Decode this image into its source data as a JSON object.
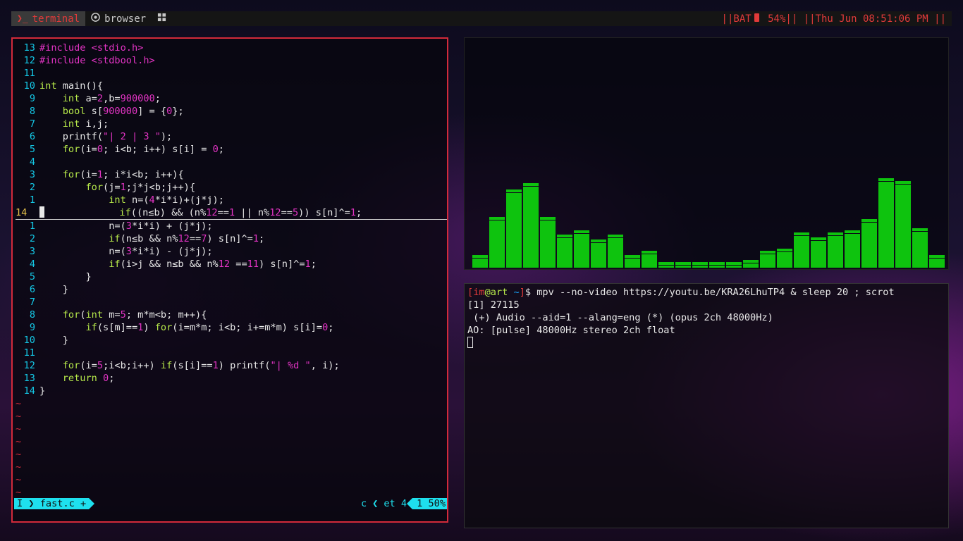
{
  "colors": {
    "accent_red": "#e03a3a",
    "cyan": "#1ee0ee",
    "keyword_green": "#b6e84a",
    "literal_magenta": "#e334c4",
    "visualizer_green": "#0ec30e"
  },
  "topbar": {
    "workspaces": [
      {
        "label": "terminal",
        "icon": "terminal-icon"
      },
      {
        "label": "browser",
        "icon": "chrome-icon"
      },
      {
        "label": "",
        "icon": "grid-icon"
      }
    ],
    "status_prefix": "||BAT",
    "battery_icon": "battery-icon",
    "battery_text": " 54%|| ||Thu Jun 08:51:06 PM ||"
  },
  "vim": {
    "lines": [
      {
        "ln": "13",
        "tokens": [
          {
            "t": "#include ",
            "c": "n"
          },
          {
            "t": "<stdio.h>",
            "c": "s"
          }
        ]
      },
      {
        "ln": "12",
        "tokens": [
          {
            "t": "#include ",
            "c": "n"
          },
          {
            "t": "<stdbool.h>",
            "c": "s"
          }
        ]
      },
      {
        "ln": "11",
        "tokens": []
      },
      {
        "ln": "10",
        "tokens": [
          {
            "t": "int",
            "c": "k"
          },
          {
            "t": " main(){",
            "c": "t"
          }
        ]
      },
      {
        "ln": "9",
        "tokens": [
          {
            "t": "    ",
            "c": "t"
          },
          {
            "t": "int",
            "c": "k"
          },
          {
            "t": " a=",
            "c": "t"
          },
          {
            "t": "2",
            "c": "n"
          },
          {
            "t": ",b=",
            "c": "t"
          },
          {
            "t": "900000",
            "c": "n"
          },
          {
            "t": ";",
            "c": "t"
          }
        ]
      },
      {
        "ln": "8",
        "tokens": [
          {
            "t": "    ",
            "c": "t"
          },
          {
            "t": "bool",
            "c": "k"
          },
          {
            "t": " s[",
            "c": "t"
          },
          {
            "t": "900000",
            "c": "n"
          },
          {
            "t": "] = {",
            "c": "t"
          },
          {
            "t": "0",
            "c": "n"
          },
          {
            "t": "};",
            "c": "t"
          }
        ]
      },
      {
        "ln": "7",
        "tokens": [
          {
            "t": "    ",
            "c": "t"
          },
          {
            "t": "int",
            "c": "k"
          },
          {
            "t": " i,j;",
            "c": "t"
          }
        ]
      },
      {
        "ln": "6",
        "tokens": [
          {
            "t": "    printf(",
            "c": "t"
          },
          {
            "t": "\"| 2 | 3 \"",
            "c": "s"
          },
          {
            "t": ");",
            "c": "t"
          }
        ]
      },
      {
        "ln": "5",
        "tokens": [
          {
            "t": "    ",
            "c": "t"
          },
          {
            "t": "for",
            "c": "k"
          },
          {
            "t": "(i=",
            "c": "t"
          },
          {
            "t": "0",
            "c": "n"
          },
          {
            "t": "; i<b; i++) s[i] = ",
            "c": "t"
          },
          {
            "t": "0",
            "c": "n"
          },
          {
            "t": ";",
            "c": "t"
          }
        ]
      },
      {
        "ln": "4",
        "tokens": []
      },
      {
        "ln": "3",
        "tokens": [
          {
            "t": "    ",
            "c": "t"
          },
          {
            "t": "for",
            "c": "k"
          },
          {
            "t": "(i=",
            "c": "t"
          },
          {
            "t": "1",
            "c": "n"
          },
          {
            "t": "; i*i<b; i++){",
            "c": "t"
          }
        ]
      },
      {
        "ln": "2",
        "tokens": [
          {
            "t": "        ",
            "c": "t"
          },
          {
            "t": "for",
            "c": "k"
          },
          {
            "t": "(j=",
            "c": "t"
          },
          {
            "t": "1",
            "c": "n"
          },
          {
            "t": ";j*j<b;j++){",
            "c": "t"
          }
        ]
      },
      {
        "ln": "1",
        "tokens": [
          {
            "t": "            ",
            "c": "t"
          },
          {
            "t": "int",
            "c": "k"
          },
          {
            "t": " n=(",
            "c": "t"
          },
          {
            "t": "4",
            "c": "n"
          },
          {
            "t": "*i*i)+(j*j);",
            "c": "t"
          }
        ]
      },
      {
        "ln": "14",
        "current": true,
        "tokens": [
          {
            "t": "            ",
            "c": "t"
          },
          {
            "t": "if",
            "c": "k"
          },
          {
            "t": "((n≤b) && (n%",
            "c": "t"
          },
          {
            "t": "12",
            "c": "n"
          },
          {
            "t": "==",
            "c": "t"
          },
          {
            "t": "1",
            "c": "n"
          },
          {
            "t": " || n%",
            "c": "t"
          },
          {
            "t": "12",
            "c": "n"
          },
          {
            "t": "==",
            "c": "t"
          },
          {
            "t": "5",
            "c": "n"
          },
          {
            "t": ")) s[n]^=",
            "c": "t"
          },
          {
            "t": "1",
            "c": "n"
          },
          {
            "t": ";",
            "c": "t"
          }
        ]
      },
      {
        "ln": "1",
        "tokens": [
          {
            "t": "            n=(",
            "c": "t"
          },
          {
            "t": "3",
            "c": "n"
          },
          {
            "t": "*i*i) + (j*j);",
            "c": "t"
          }
        ]
      },
      {
        "ln": "2",
        "tokens": [
          {
            "t": "            ",
            "c": "t"
          },
          {
            "t": "if",
            "c": "k"
          },
          {
            "t": "(n≤b && n%",
            "c": "t"
          },
          {
            "t": "12",
            "c": "n"
          },
          {
            "t": "==",
            "c": "t"
          },
          {
            "t": "7",
            "c": "n"
          },
          {
            "t": ") s[n]^=",
            "c": "t"
          },
          {
            "t": "1",
            "c": "n"
          },
          {
            "t": ";",
            "c": "t"
          }
        ]
      },
      {
        "ln": "3",
        "tokens": [
          {
            "t": "            n=(",
            "c": "t"
          },
          {
            "t": "3",
            "c": "n"
          },
          {
            "t": "*i*i) - (j*j);",
            "c": "t"
          }
        ]
      },
      {
        "ln": "4",
        "tokens": [
          {
            "t": "            ",
            "c": "t"
          },
          {
            "t": "if",
            "c": "k"
          },
          {
            "t": "(i>j && n≤b && n%",
            "c": "t"
          },
          {
            "t": "12",
            "c": "n"
          },
          {
            "t": " ==",
            "c": "t"
          },
          {
            "t": "11",
            "c": "n"
          },
          {
            "t": ") s[n]^=",
            "c": "t"
          },
          {
            "t": "1",
            "c": "n"
          },
          {
            "t": ";",
            "c": "t"
          }
        ]
      },
      {
        "ln": "5",
        "tokens": [
          {
            "t": "        }",
            "c": "t"
          }
        ]
      },
      {
        "ln": "6",
        "tokens": [
          {
            "t": "    }",
            "c": "t"
          }
        ]
      },
      {
        "ln": "7",
        "tokens": []
      },
      {
        "ln": "8",
        "tokens": [
          {
            "t": "    ",
            "c": "t"
          },
          {
            "t": "for",
            "c": "k"
          },
          {
            "t": "(",
            "c": "t"
          },
          {
            "t": "int",
            "c": "k"
          },
          {
            "t": " m=",
            "c": "t"
          },
          {
            "t": "5",
            "c": "n"
          },
          {
            "t": "; m*m<b; m++){",
            "c": "t"
          }
        ]
      },
      {
        "ln": "9",
        "tokens": [
          {
            "t": "        ",
            "c": "t"
          },
          {
            "t": "if",
            "c": "k"
          },
          {
            "t": "(s[m]==",
            "c": "t"
          },
          {
            "t": "1",
            "c": "n"
          },
          {
            "t": ") ",
            "c": "t"
          },
          {
            "t": "for",
            "c": "k"
          },
          {
            "t": "(i=m*m; i<b; i+=m*m) s[i]=",
            "c": "t"
          },
          {
            "t": "0",
            "c": "n"
          },
          {
            "t": ";",
            "c": "t"
          }
        ]
      },
      {
        "ln": "10",
        "tokens": [
          {
            "t": "    }",
            "c": "t"
          }
        ]
      },
      {
        "ln": "11",
        "tokens": []
      },
      {
        "ln": "12",
        "tokens": [
          {
            "t": "    ",
            "c": "t"
          },
          {
            "t": "for",
            "c": "k"
          },
          {
            "t": "(i=",
            "c": "t"
          },
          {
            "t": "5",
            "c": "n"
          },
          {
            "t": ";i<b;i++) ",
            "c": "t"
          },
          {
            "t": "if",
            "c": "k"
          },
          {
            "t": "(s[i]==",
            "c": "t"
          },
          {
            "t": "1",
            "c": "n"
          },
          {
            "t": ") printf(",
            "c": "t"
          },
          {
            "t": "\"| %d \"",
            "c": "s"
          },
          {
            "t": ", i);",
            "c": "t"
          }
        ]
      },
      {
        "ln": "13",
        "tokens": [
          {
            "t": "    ",
            "c": "t"
          },
          {
            "t": "return",
            "c": "k"
          },
          {
            "t": " ",
            "c": "t"
          },
          {
            "t": "0",
            "c": "n"
          },
          {
            "t": ";",
            "c": "t"
          }
        ]
      },
      {
        "ln": "14",
        "tokens": [
          {
            "t": "}",
            "c": "t"
          }
        ]
      }
    ],
    "tilde_count": 8,
    "tilde_char": "~",
    "status": {
      "mode": "I",
      "file": "fast.c +",
      "filetype": "c",
      "indent": "et 4",
      "position": "1  50%"
    }
  },
  "visualizer": {
    "levels": [
      0.04,
      0.21,
      0.33,
      0.36,
      0.21,
      0.13,
      0.15,
      0.11,
      0.13,
      0.04,
      0.06,
      0.01,
      0.01,
      0.01,
      0.01,
      0.01,
      0.02,
      0.06,
      0.07,
      0.14,
      0.12,
      0.14,
      0.15,
      0.2,
      0.38,
      0.37,
      0.16,
      0.04
    ]
  },
  "terminal": {
    "prompt_bracket_open": "[",
    "prompt_user": "im",
    "prompt_at": "@",
    "prompt_host": "art",
    "prompt_dir": " ~",
    "prompt_bracket_close": "]",
    "prompt_symbol": "$ ",
    "command": "mpv --no-video https://youtu.be/KRA26LhuTP4 & sleep 20 ; scrot",
    "output": [
      "[1] 27115",
      " (+) Audio --aid=1 --alang=eng (*) (opus 2ch 48000Hz)",
      "AO: [pulse] 48000Hz stereo 2ch float"
    ]
  }
}
